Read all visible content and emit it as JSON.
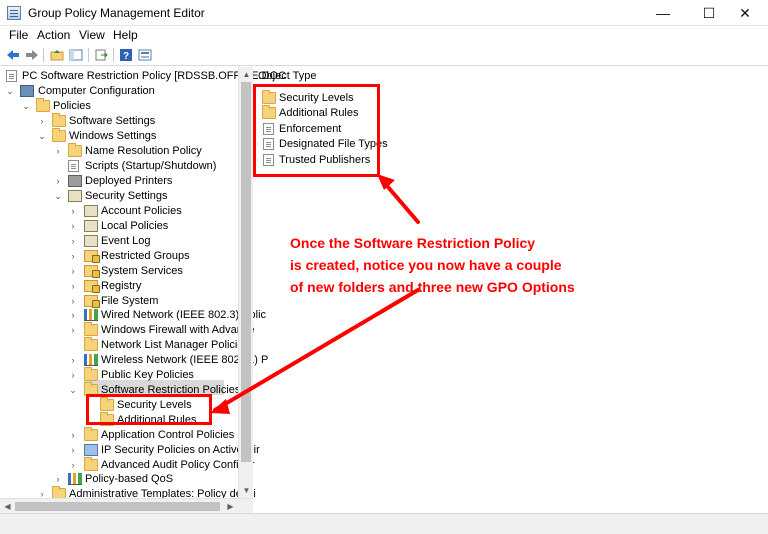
{
  "window": {
    "title": "Group Policy Management Editor",
    "controls": {
      "minimize": "—",
      "maximize": "☐",
      "close": "✕"
    }
  },
  "menu": [
    "File",
    "Action",
    "View",
    "Help"
  ],
  "toolbar": {
    "icons": [
      "back-arrow-icon",
      "forward-arrow-icon",
      "up-folder-icon",
      "show-hide-tree-icon",
      "export-list-icon",
      "help-icon",
      "properties-icon"
    ]
  },
  "tree": {
    "root": "PC Software Restriction Policy [RDSSB.OFFICE.DOC",
    "computer_configuration": "Computer Configuration",
    "policies": "Policies",
    "software_settings": "Software Settings",
    "windows_settings": "Windows Settings",
    "name_resolution_policy": "Name Resolution Policy",
    "scripts": "Scripts (Startup/Shutdown)",
    "deployed_printers": "Deployed Printers",
    "security_settings": "Security Settings",
    "account_policies": "Account Policies",
    "local_policies": "Local Policies",
    "event_log": "Event Log",
    "restricted_groups": "Restricted Groups",
    "system_services": "System Services",
    "registry": "Registry",
    "file_system": "File System",
    "wired_network": "Wired Network (IEEE 802.3) Polic",
    "windows_firewall": "Windows Firewall with Advance",
    "network_list_manager": "Network List Manager Policies",
    "wireless_network": "Wireless Network (IEEE 802.11) P",
    "public_key_policies": "Public Key Policies",
    "software_restriction_policies": "Software Restriction Policies",
    "security_levels": "Security Levels",
    "additional_rules": "Additional Rules",
    "application_control_policies": "Application Control Policies",
    "ip_security_policies": "IP Security Policies on Active Dir",
    "advanced_audit_policy": "Advanced Audit Policy Configur",
    "policy_based_qos": "Policy-based QoS",
    "administrative_templates": "Administrative Templates: Policy defini"
  },
  "right_pane": {
    "column_header": "Object Type",
    "items": [
      "Security Levels",
      "Additional Rules",
      "Enforcement",
      "Designated File Types",
      "Trusted Publishers"
    ]
  },
  "annotation": {
    "lines": [
      "Once the Software Restriction Policy",
      "is created, notice you now have a couple",
      "of new folders and three new GPO Options"
    ],
    "color": "#ff0000"
  }
}
